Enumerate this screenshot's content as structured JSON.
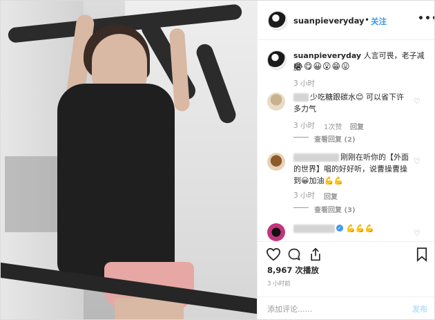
{
  "post": {
    "username": "suanpieveryday",
    "follow_label": "关注",
    "more_icon": "more-icon",
    "caption_text": "人言可畏，老子减肥",
    "caption_emojis": "😭😋😀😮😁😛",
    "caption_time": "3 小时"
  },
  "comments": [
    {
      "text": "少吃糖跟碳水😊 可以省下许多力气",
      "time": "3 小时",
      "likes": "1次赞",
      "reply_label": "回复",
      "view_replies": "查看回复 (2)"
    },
    {
      "text": "刚刚在听你的【外面的世界】唱的好好听，说曹操曹操到😀加油💪💪",
      "time": "3 小时",
      "reply_label": "回复",
      "view_replies": "查看回复 (3)"
    },
    {
      "text": "💪💪💪"
    }
  ],
  "actions": {
    "likes_count": "8,967",
    "likes_label": "次播放",
    "posted_time": "3 小时前"
  },
  "add_comment": {
    "placeholder": "添加评论......",
    "post_label": "发布"
  },
  "colors": {
    "accent": "#3897f0",
    "muted": "#999999",
    "text": "#262626"
  }
}
